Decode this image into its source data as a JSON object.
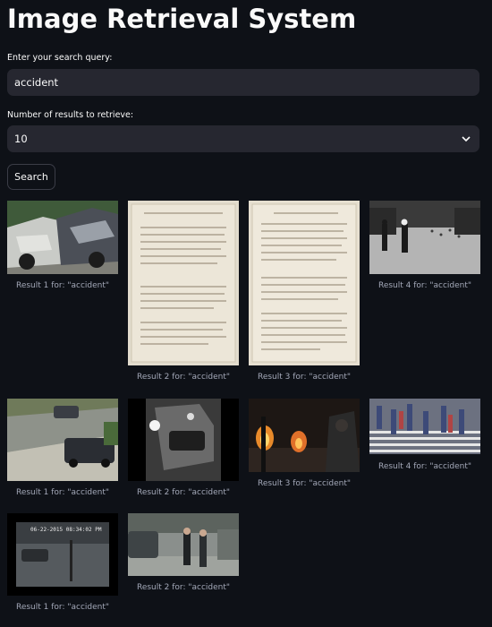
{
  "app": {
    "title": "Image Retrieval System"
  },
  "query": {
    "label": "Enter your search query:",
    "value": "accident"
  },
  "num_results": {
    "label": "Number of results to retrieve:",
    "selected": "10"
  },
  "search_button": {
    "label": "Search"
  },
  "results": [
    {
      "caption": "Result 1 for: \"accident\""
    },
    {
      "caption": "Result 2 for: \"accident\""
    },
    {
      "caption": "Result 3 for: \"accident\""
    },
    {
      "caption": "Result 4 for: \"accident\""
    },
    {
      "caption": "Result 1 for: \"accident\""
    },
    {
      "caption": "Result 2 for: \"accident\""
    },
    {
      "caption": "Result 3 for: \"accident\""
    },
    {
      "caption": "Result 4 for: \"accident\""
    },
    {
      "caption": "Result 1 for: \"accident\""
    },
    {
      "caption": "Result 2 for: \"accident\""
    }
  ],
  "colors": {
    "background": "#0e1117",
    "input_bg": "#262730",
    "caption": "#a3a8b8"
  }
}
